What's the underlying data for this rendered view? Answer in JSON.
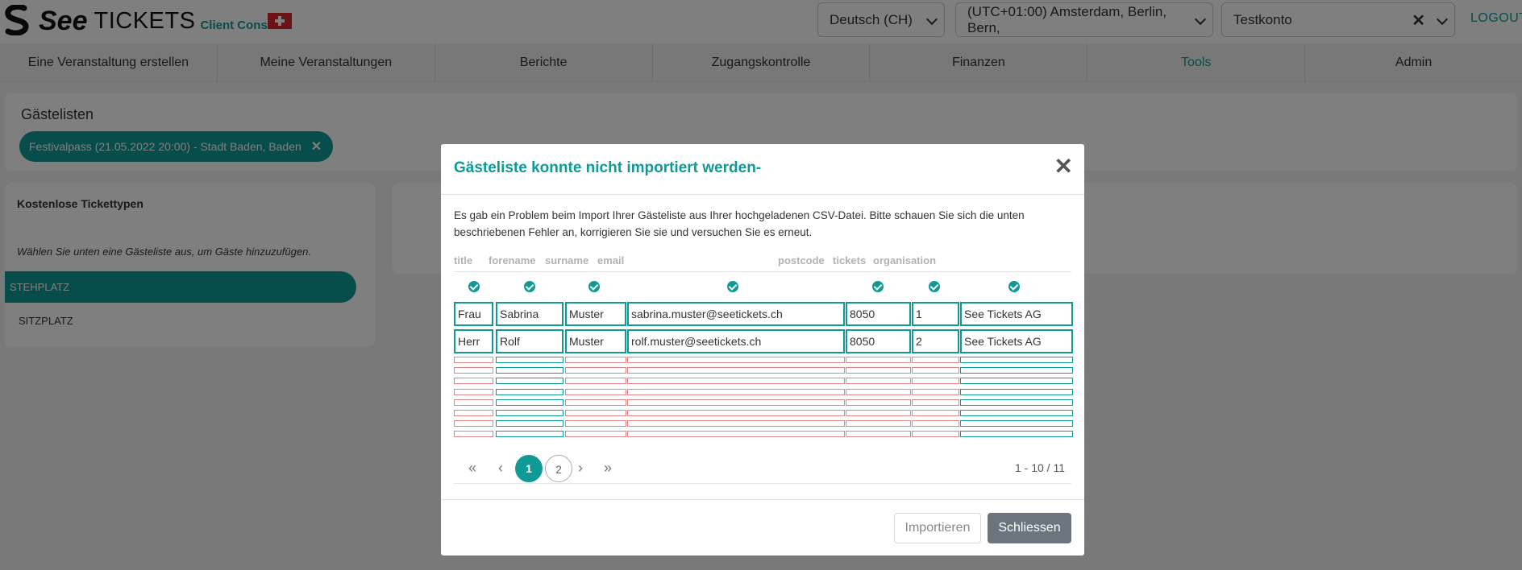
{
  "header": {
    "brand_see": "See",
    "brand_tickets": "TICKETS",
    "brand_console": "Client Console",
    "language": "Deutsch (CH)",
    "timezone": "(UTC+01:00) Amsterdam, Berlin, Bern,",
    "account": "Testkonto",
    "logout": "LOGOUT"
  },
  "nav": [
    {
      "label": "Eine Veranstaltung erstellen"
    },
    {
      "label": "Meine Veranstaltungen"
    },
    {
      "label": "Berichte"
    },
    {
      "label": "Zugangskontrolle"
    },
    {
      "label": "Finanzen"
    },
    {
      "label": "Tools"
    },
    {
      "label": "Admin"
    }
  ],
  "page": {
    "title": "Gästelisten",
    "event_chip": "Festivalpass (21.05.2022 20:00) - Stadt Baden, Baden"
  },
  "sidebar": {
    "heading": "Kostenlose Tickettypen",
    "hint": "Wählen Sie unten eine Gästeliste aus, um Gäste hinzuzufügen.",
    "items": [
      "STEHPLATZ",
      "SITZPLATZ"
    ]
  },
  "modal": {
    "title": "Gästeliste konnte nicht importiert werden-",
    "close_symbol": "✕",
    "message": "Es gab ein Problem beim Import Ihrer Gästeliste aus Ihrer hochgeladenen CSV-Datei. Bitte schauen Sie sich die unten beschriebenen Fehler an, korrigieren Sie sie und versuchen Sie es erneut.",
    "columns": [
      "title",
      "forename",
      "surname",
      "email",
      "postcode",
      "tickets",
      "organisation"
    ],
    "rows": [
      [
        "Frau",
        "Sabrina",
        "Muster",
        "sabrina.muster@seetickets.ch",
        "8050",
        "1",
        "See Tickets AG"
      ],
      [
        "Herr",
        "Rolf",
        "Muster",
        "rolf.muster@seetickets.ch",
        "8050",
        "2",
        "See Tickets AG"
      ]
    ],
    "pagination": {
      "first": "«",
      "prev": "‹",
      "pages": [
        "1",
        "2"
      ],
      "next": "›",
      "last": "»",
      "range": "1 - 10 / 11"
    },
    "import_button": "Importieren",
    "close_button": "Schliessen"
  },
  "colors": {
    "accent": "#0f9a96",
    "error_border": "#e08585"
  }
}
